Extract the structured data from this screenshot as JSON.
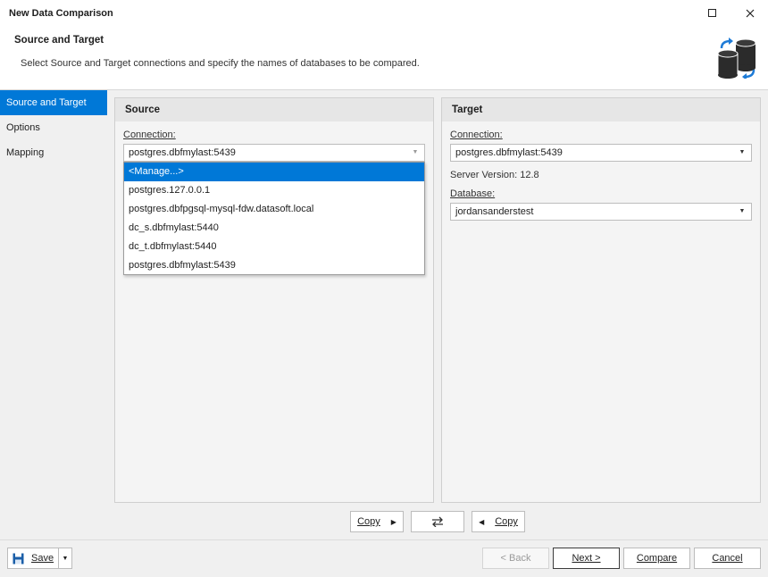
{
  "window": {
    "title": "New Data Comparison",
    "maximize_icon": "maximize-icon",
    "close_icon": "close-icon"
  },
  "header": {
    "title": "Source and Target",
    "description": "Select Source and Target connections and specify the names of databases to be compared.",
    "logo_icon": "database-compare-icon"
  },
  "nav": {
    "items": [
      "Source and Target",
      "Options",
      "Mapping"
    ],
    "active": 0
  },
  "source": {
    "heading": "Source",
    "connection_label": "Connection:",
    "connection_value": "postgres.dbfmylast:5439",
    "dropdown_items": [
      "<Manage...>",
      "postgres.127.0.0.1",
      "postgres.dbfpgsql-mysql-fdw.datasoft.local",
      "dc_s.dbfmylast:5440",
      "dc_t.dbfmylast:5440",
      "postgres.dbfmylast:5439"
    ],
    "selected_index": 0
  },
  "target": {
    "heading": "Target",
    "connection_label": "Connection:",
    "connection_value": "postgres.dbfmylast:5439",
    "server_version": "Server Version: 12.8",
    "database_label": "Database:",
    "database_value": "jordansanderstest"
  },
  "copy_bar": {
    "copy_right_label": "Copy",
    "copy_left_label": "Copy",
    "swap_icon": "swap-arrows-icon"
  },
  "footer": {
    "save_label": "Save",
    "back_label": "< Back",
    "next_label": "Next >",
    "compare_label": "Compare",
    "cancel_label": "Cancel"
  },
  "colors": {
    "accent": "#0078d7"
  }
}
